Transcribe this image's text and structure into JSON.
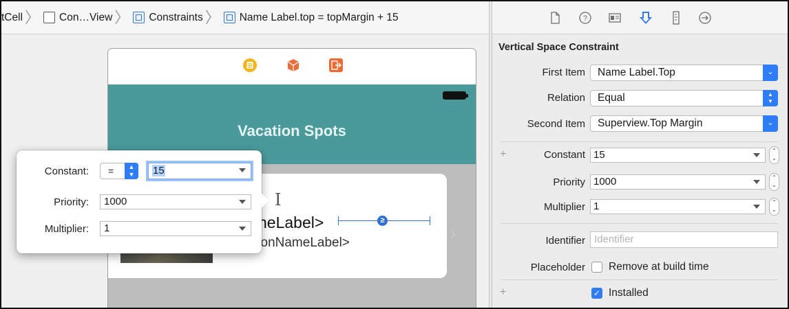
{
  "jumpbar": {
    "items": [
      {
        "label": "tCell"
      },
      {
        "label": "Con…View"
      },
      {
        "label": "Constraints"
      },
      {
        "label": "Name Label.top = topMargin + 15"
      }
    ]
  },
  "scene": {
    "nav_title": "Vacation Spots",
    "name_label": "neLabel>",
    "sub_label": "tionNameLabel>"
  },
  "popover": {
    "constant_label": "Constant:",
    "relation_value": "=",
    "constant_value": "15",
    "priority_label": "Priority:",
    "priority_value": "1000",
    "multiplier_label": "Multiplier:",
    "multiplier_value": "1"
  },
  "inspector": {
    "section_title": "Vertical Space Constraint",
    "first_item_label": "First Item",
    "first_item_value": "Name Label.Top",
    "relation_label": "Relation",
    "relation_value": "Equal",
    "second_item_label": "Second Item",
    "second_item_value": "Superview.Top Margin",
    "constant_label": "Constant",
    "constant_value": "15",
    "priority_label": "Priority",
    "priority_value": "1000",
    "multiplier_label": "Multiplier",
    "multiplier_value": "1",
    "identifier_label": "Identifier",
    "identifier_placeholder": "Identifier",
    "placeholder_label": "Placeholder",
    "remove_at_build_label": "Remove at build time",
    "remove_at_build_checked": false,
    "installed_label": "Installed",
    "installed_checked": true
  },
  "colors": {
    "accent": "#2e7cf6",
    "navbar": "#4a9a9c",
    "constraint": "#2f6fd1"
  },
  "icons": [
    "file-icon",
    "help-icon",
    "identity-icon",
    "attributes-icon",
    "size-icon",
    "connections-icon"
  ]
}
